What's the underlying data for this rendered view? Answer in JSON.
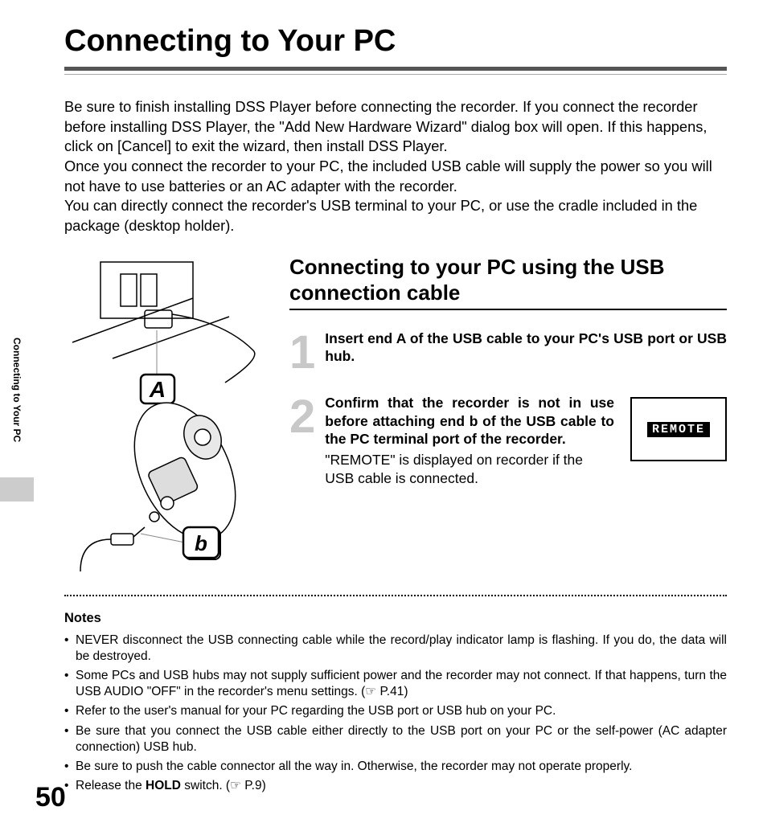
{
  "title": "Connecting to Your PC",
  "sideLabel": "Connecting to Your PC",
  "pageNumber": "50",
  "intro": "Be sure to finish installing DSS Player before connecting the recorder. If you connect the recorder before installing DSS Player, the \"Add New Hardware Wizard\" dialog box will open. If this happens, click on [Cancel] to exit the wizard, then install DSS Player.\nOnce you connect the recorder to your PC, the included USB cable will supply the power so you will not have to use batteries or an AC adapter with the recorder.\nYou can directly connect the recorder's USB terminal to your PC, or use the cradle included in the package (desktop holder).",
  "subhead": "Connecting to your PC using the USB connection cable",
  "diagramLabels": {
    "a": "A",
    "b": "b"
  },
  "step1": {
    "num": "1",
    "bold": "Insert end A of the USB cable to your PC's USB port or USB hub."
  },
  "step2": {
    "num": "2",
    "bold": "Confirm that the recorder is not in use before attaching end b of the USB cable to the PC terminal port of the recorder.",
    "plain": "\"REMOTE\" is displayed on recorder if the USB cable is connected.",
    "badge": "REMOTE"
  },
  "notesHead": "Notes",
  "notes": [
    "NEVER disconnect the USB connecting cable while the record/play indicator lamp is flashing. If you do, the data will be destroyed.",
    "Some PCs and USB hubs may not supply sufficient power and the recorder may not connect. If that happens, turn the USB AUDIO \"OFF\" in the recorder's menu settings. (☞ P.41)",
    "Refer to the user's manual for your PC regarding the USB port or USB hub on your PC.",
    "Be sure that you connect the USB cable either directly to the USB port on your PC or the self-power (AC adapter connection) USB hub.",
    "Be sure to push the cable connector all the way in. Otherwise, the recorder may not operate properly.",
    "Release the HOLD switch. (☞ P.9)"
  ],
  "notesBoldWord": "HOLD"
}
